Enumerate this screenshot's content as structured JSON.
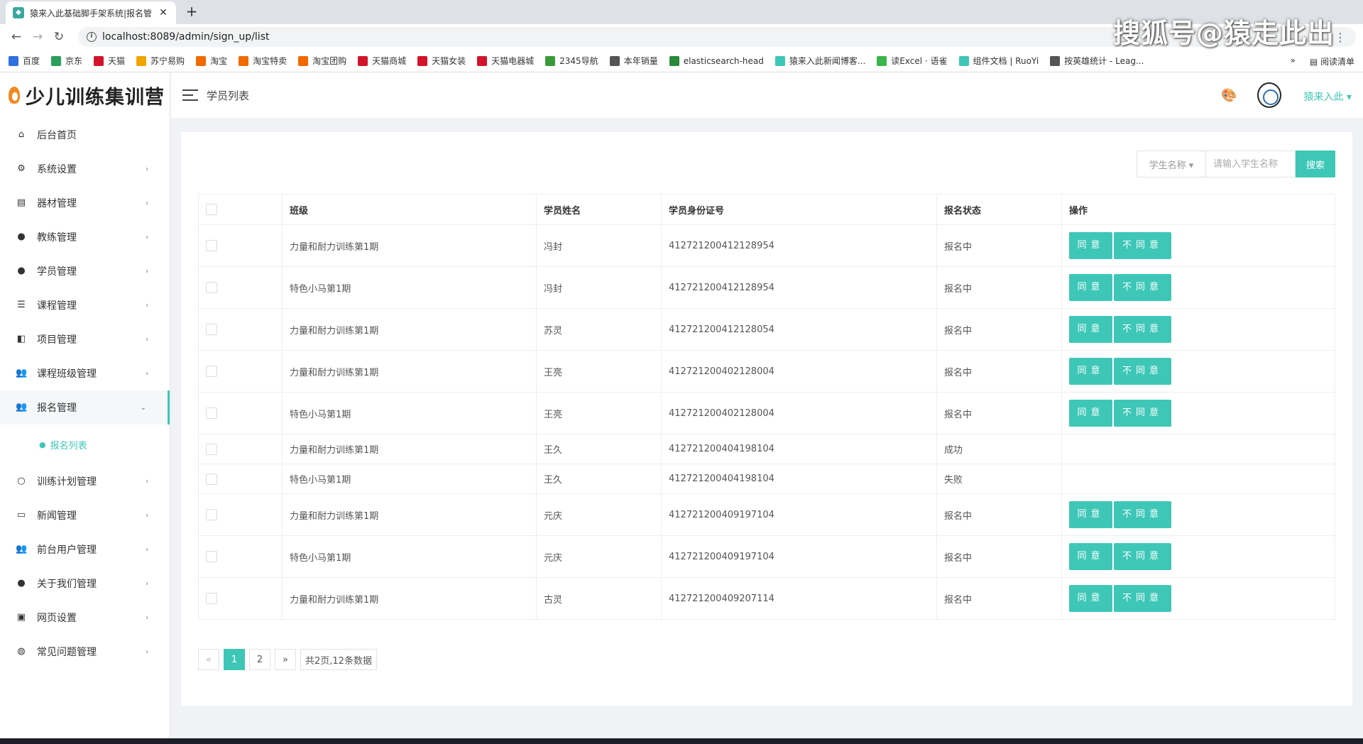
{
  "browser": {
    "tab_title": "猿来入此基础脚手架系统|报名管理",
    "url": "localhost:8089/admin/sign_up/list",
    "bookmarks": [
      {
        "label": "百度",
        "icon": "paw-icon",
        "color": "#2f6fe0"
      },
      {
        "label": "京东",
        "icon": "jd-icon",
        "color": "#2aa05a"
      },
      {
        "label": "天猫",
        "icon": "tmall-icon",
        "color": "#d2142a"
      },
      {
        "label": "苏宁易购",
        "icon": "suning-icon",
        "color": "#f0a400"
      },
      {
        "label": "淘宝",
        "icon": "taobao-icon",
        "color": "#f06a00"
      },
      {
        "label": "淘宝特卖",
        "icon": "taobao-icon",
        "color": "#f06a00"
      },
      {
        "label": "淘宝团购",
        "icon": "taobao-icon",
        "color": "#f06a00"
      },
      {
        "label": "天猫商城",
        "icon": "tmall-icon",
        "color": "#d2142a"
      },
      {
        "label": "天猫女装",
        "icon": "tmall-icon",
        "color": "#d2142a"
      },
      {
        "label": "天猫电器城",
        "icon": "tmall-icon",
        "color": "#d2142a"
      },
      {
        "label": "2345导航",
        "icon": "house-icon",
        "color": "#3a9a3a"
      },
      {
        "label": "本年销量",
        "icon": "globe-icon",
        "color": "#555555"
      },
      {
        "label": "elasticsearch-head",
        "icon": "elastic-icon",
        "color": "#2a8a3a"
      },
      {
        "label": "猿来入此新闻博客...",
        "icon": "blog-icon",
        "color": "#3ec7b7"
      },
      {
        "label": "读Excel · 语雀",
        "icon": "yuque-icon",
        "color": "#39b54a"
      },
      {
        "label": "组件文档 | RuoYi",
        "icon": "ruoyi-icon",
        "color": "#3ec7b7"
      },
      {
        "label": "按英雄统计 - Leag...",
        "icon": "globe-icon",
        "color": "#555555"
      }
    ],
    "reading_list": "阅读清单",
    "more": "»"
  },
  "watermark": "搜狐号@猿走此出",
  "app": {
    "logo_text": "少儿训练集训营",
    "page_title": "学员列表",
    "user_name": "猿来入此 ▾",
    "menu": [
      {
        "label": "后台首页",
        "icon": "home-icon",
        "glyph": "⌂",
        "has_children": false
      },
      {
        "label": "系统设置",
        "icon": "gear-icon",
        "glyph": "⚙",
        "has_children": true
      },
      {
        "label": "器材管理",
        "icon": "server-icon",
        "glyph": "▤",
        "has_children": true
      },
      {
        "label": "教练管理",
        "icon": "user-icon",
        "glyph": "●",
        "has_children": true
      },
      {
        "label": "学员管理",
        "icon": "user-icon",
        "glyph": "●",
        "has_children": true
      },
      {
        "label": "课程管理",
        "icon": "list-icon",
        "glyph": "☰",
        "has_children": true
      },
      {
        "label": "项目管理",
        "icon": "book-icon",
        "glyph": "◧",
        "has_children": true
      },
      {
        "label": "课程班级管理",
        "icon": "users-icon",
        "glyph": "👥",
        "has_children": true
      },
      {
        "label": "报名管理",
        "icon": "user-plus-icon",
        "glyph": "👥",
        "has_children": true,
        "open": true
      }
    ],
    "submenu_active": "报名列表",
    "menu_after": [
      {
        "label": "训练计划管理",
        "icon": "user-outline-icon",
        "glyph": "○"
      },
      {
        "label": "新闻管理",
        "icon": "monitor-icon",
        "glyph": "▭"
      },
      {
        "label": "前台用户管理",
        "icon": "users-icon",
        "glyph": "👥"
      },
      {
        "label": "关于我们管理",
        "icon": "user-icon",
        "glyph": "●"
      },
      {
        "label": "网页设置",
        "icon": "webpage-icon",
        "glyph": "▣"
      },
      {
        "label": "常见问题管理",
        "icon": "globe-icon",
        "glyph": "◍"
      }
    ]
  },
  "search": {
    "select_label": "学生名称 ▾",
    "placeholder": "请输入学生名称",
    "button": "搜索"
  },
  "table": {
    "headers": [
      "班级",
      "学员姓名",
      "学员身份证号",
      "报名状态",
      "操作"
    ],
    "agree": "同意",
    "disagree": "不同意",
    "rows": [
      {
        "class": "力量和耐力训练第1期",
        "name": "冯封",
        "id": "412721200412128954",
        "status": "报名中",
        "actions": true
      },
      {
        "class": "特色小马第1期",
        "name": "冯封",
        "id": "412721200412128954",
        "status": "报名中",
        "actions": true
      },
      {
        "class": "力量和耐力训练第1期",
        "name": "苏灵",
        "id": "412721200412128054",
        "status": "报名中",
        "actions": true
      },
      {
        "class": "力量和耐力训练第1期",
        "name": "王亮",
        "id": "412721200402128004",
        "status": "报名中",
        "actions": true
      },
      {
        "class": "特色小马第1期",
        "name": "王亮",
        "id": "412721200402128004",
        "status": "报名中",
        "actions": true
      },
      {
        "class": "力量和耐力训练第1期",
        "name": "王久",
        "id": "412721200404198104",
        "status": "成功",
        "actions": false
      },
      {
        "class": "特色小马第1期",
        "name": "王久",
        "id": "412721200404198104",
        "status": "失败",
        "actions": false
      },
      {
        "class": "力量和耐力训练第1期",
        "name": "元庆",
        "id": "412721200409197104",
        "status": "报名中",
        "actions": true
      },
      {
        "class": "特色小马第1期",
        "name": "元庆",
        "id": "412721200409197104",
        "status": "报名中",
        "actions": true
      },
      {
        "class": "力量和耐力训练第1期",
        "name": "古灵",
        "id": "412721200409207114",
        "status": "报名中",
        "actions": true
      }
    ]
  },
  "pagination": {
    "prev": "«",
    "pages": [
      "1",
      "2"
    ],
    "current": "1",
    "next": "»",
    "summary": "共2页,12条数据"
  },
  "colors": {
    "accent": "#3ec7b7"
  }
}
